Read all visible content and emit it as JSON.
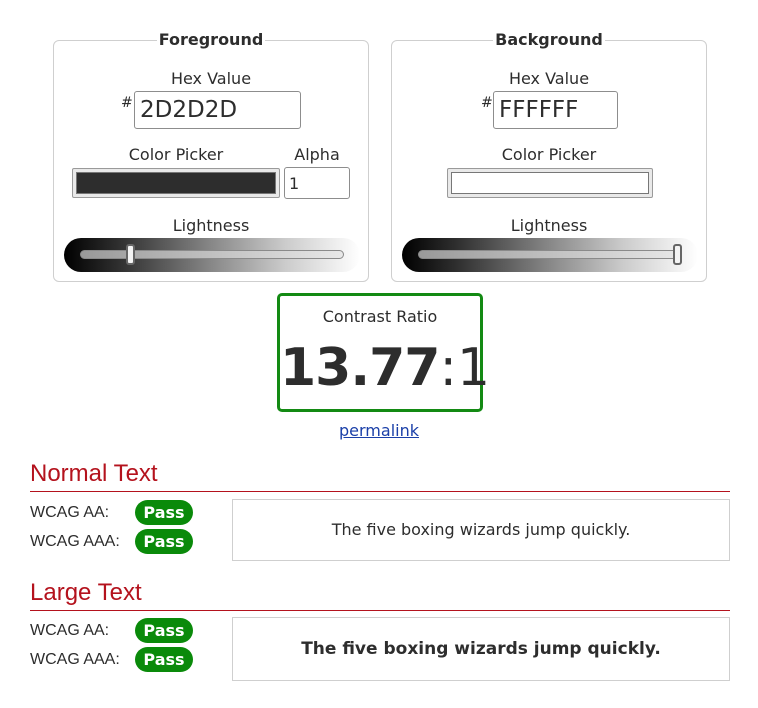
{
  "foreground": {
    "legend": "Foreground",
    "hex_label": "Hex Value",
    "hash": "#",
    "hex_value": "2D2D2D",
    "picker_label": "Color Picker",
    "picker_color": "#2d2d2d",
    "alpha_label": "Alpha",
    "alpha_value": "1",
    "lightness_label": "Lightness",
    "lightness_fraction": 0.18
  },
  "background": {
    "legend": "Background",
    "hex_label": "Hex Value",
    "hash": "#",
    "hex_value": "FFFFFF",
    "picker_label": "Color Picker",
    "picker_color": "#ffffff",
    "lightness_label": "Lightness",
    "lightness_fraction": 1.0
  },
  "contrast": {
    "title": "Contrast Ratio",
    "value": "13.77",
    "suffix": ":1",
    "border_color": "#138a13",
    "permalink": "permalink"
  },
  "normal_text": {
    "title": "Normal Text",
    "aa_label": "WCAG AA:",
    "aa_result": "Pass",
    "aaa_label": "WCAG AAA:",
    "aaa_result": "Pass",
    "sample": "The five boxing wizards jump quickly."
  },
  "large_text": {
    "title": "Large Text",
    "aa_label": "WCAG AA:",
    "aa_result": "Pass",
    "aaa_label": "WCAG AAA:",
    "aaa_result": "Pass",
    "sample": "The five boxing wizards jump quickly."
  },
  "colors": {
    "accent_red": "#b4121d",
    "pass_green": "#0a8a0a",
    "link_blue": "#1a3fa8"
  }
}
